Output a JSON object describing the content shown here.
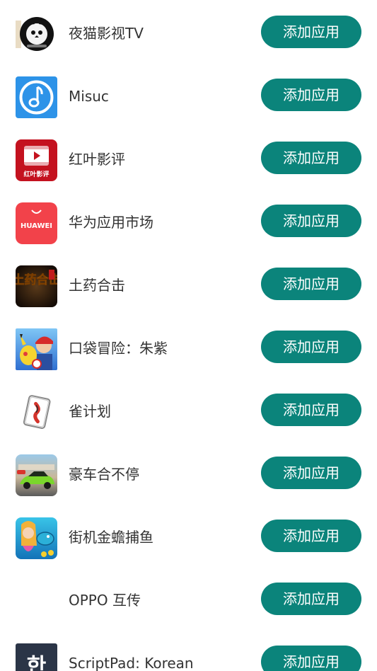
{
  "apps": [
    {
      "name": "夜猫影视TV",
      "button_label": "添加应用",
      "icon": "night-cat-icon"
    },
    {
      "name": "Misuc",
      "button_label": "添加应用",
      "icon": "music-note-icon"
    },
    {
      "name": "红叶影评",
      "button_label": "添加应用",
      "icon": "video-review-icon",
      "icon_text": "红叶影评"
    },
    {
      "name": "华为应用市场",
      "button_label": "添加应用",
      "icon": "huawei-appgallery-icon",
      "icon_text": "HUAWEI"
    },
    {
      "name": "土药合击",
      "button_label": "添加应用",
      "icon": "game-logo-icon",
      "icon_text": "土药合击"
    },
    {
      "name": "口袋冒险：朱紫",
      "button_label": "添加应用",
      "icon": "pokemon-game-icon"
    },
    {
      "name": "雀计划",
      "button_label": "添加应用",
      "icon": "mahjong-tile-icon"
    },
    {
      "name": "豪车合不停",
      "button_label": "添加应用",
      "icon": "race-car-icon"
    },
    {
      "name": "街机金蟾捕鱼",
      "button_label": "添加应用",
      "icon": "fishing-game-icon"
    },
    {
      "name": "OPPO 互传",
      "button_label": "添加应用",
      "icon": "oppo-share-icon"
    },
    {
      "name": "ScriptPad: Korean",
      "button_label": "添加应用",
      "icon": "scriptpad-icon",
      "icon_text": "한"
    }
  ],
  "colors": {
    "button_bg": "#0b847b",
    "button_text": "#ffffff",
    "name_text": "#333333"
  }
}
